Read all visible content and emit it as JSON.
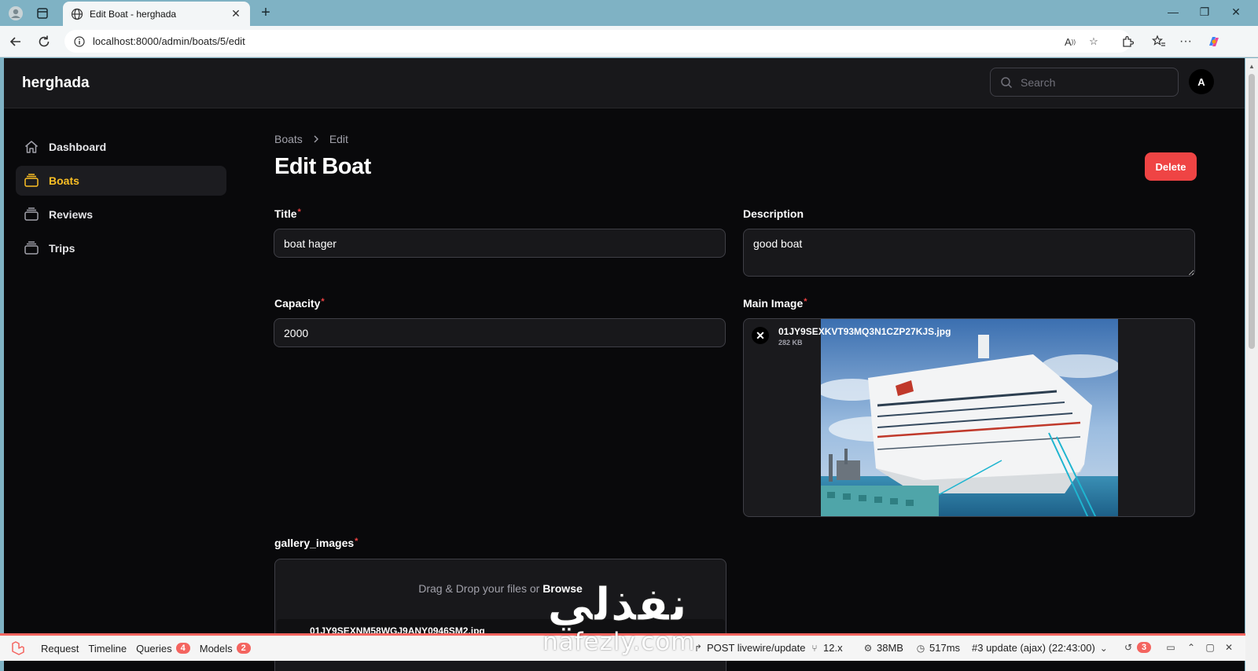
{
  "browser": {
    "tab_title": "Edit Boat - herghada",
    "url": "localhost:8000/admin/boats/5/edit"
  },
  "app": {
    "brand": "herghada",
    "search_placeholder": "Search",
    "avatar_initial": "A",
    "accent_color": "#fbbf24",
    "danger_color": "#ef4444"
  },
  "sidebar": {
    "items": [
      {
        "label": "Dashboard",
        "icon": "home-icon",
        "active": false
      },
      {
        "label": "Boats",
        "icon": "rectangle-stack-icon",
        "active": true
      },
      {
        "label": "Reviews",
        "icon": "rectangle-stack-icon",
        "active": false
      },
      {
        "label": "Trips",
        "icon": "rectangle-stack-icon",
        "active": false
      }
    ]
  },
  "page": {
    "breadcrumb": [
      "Boats",
      "Edit"
    ],
    "title": "Edit Boat",
    "delete_label": "Delete"
  },
  "form": {
    "title_label": "Title",
    "title_value": "boat hager",
    "description_label": "Description",
    "description_value": "good boat",
    "capacity_label": "Capacity",
    "capacity_value": "2000",
    "main_image_label": "Main Image",
    "main_image_file": "01JY9SEXKVT93MQ3N1CZP27KJS.jpg",
    "main_image_size": "282 KB",
    "required_mark": "*",
    "gallery_label": "gallery_images",
    "gallery_drop_text": "Drag & Drop your files or ",
    "gallery_browse": "Browse",
    "gallery_file": "01JY9SEXNM58WGJ9ANY0946SM2.jpg"
  },
  "watermark": {
    "arabic_text": "نفذلي",
    "domain": "nafezly.com"
  },
  "debugbar": {
    "request": "Request",
    "timeline": "Timeline",
    "queries": "Queries",
    "queries_count": "4",
    "models": "Models",
    "models_count": "2",
    "route": "POST livewire/update",
    "version": "12.x",
    "memory": "38MB",
    "time": "517ms",
    "update_info": "#3 update (ajax) (22:43:00)",
    "history_count": "3"
  }
}
